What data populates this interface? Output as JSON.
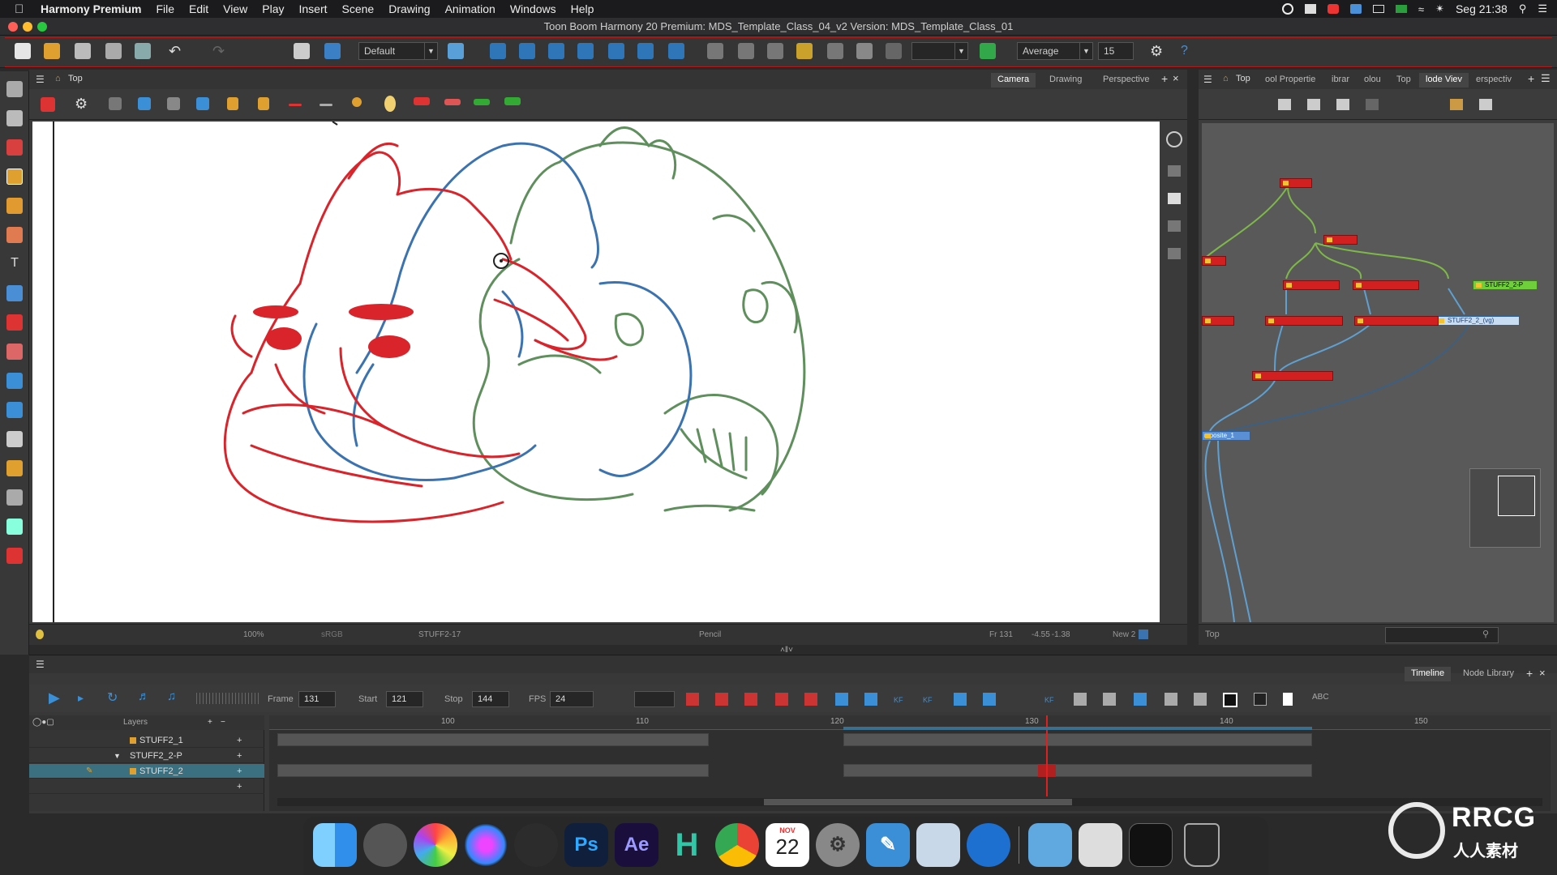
{
  "menubar": {
    "app_name": "Harmony Premium",
    "items": [
      "File",
      "Edit",
      "View",
      "Play",
      "Insert",
      "Scene",
      "Drawing",
      "Animation",
      "Windows",
      "Help"
    ],
    "clock": "Seg 21:38"
  },
  "window": {
    "title": "Toon Boom Harmony 20 Premium: MDS_Template_Class_04_v2 Version: MDS_Template_Class_01"
  },
  "toolbar": {
    "workspace_value": "Default",
    "smoothing_value": "Average",
    "size_value": "15"
  },
  "camera": {
    "breadcrumb": "Top",
    "tabs": [
      "Camera",
      "Drawing",
      "Perspective"
    ],
    "status": {
      "zoom": "100%",
      "layer": "STUFF2-17",
      "tool": "Pencil",
      "frame": "Fr 131",
      "coords": "-4.55 -1.38",
      "new": "New 2",
      "color_mode": "sRGB"
    }
  },
  "node_view": {
    "breadcrumb": "Top",
    "tabs": [
      "ool Propertie",
      "ibrar",
      "olou",
      "Top",
      "lode Viev",
      "erspectiv"
    ],
    "footer": "Top",
    "nodes": [
      {
        "label": "",
        "selected": false
      },
      {
        "label": "",
        "selected": false
      },
      {
        "label": "",
        "selected": false
      },
      {
        "label": "",
        "selected": false
      },
      {
        "label": "STUFF2_2-P",
        "selected": false
      },
      {
        "label": "",
        "selected": false
      },
      {
        "label": "",
        "selected": false
      },
      {
        "label": "",
        "selected": false
      },
      {
        "label": "STUFF2_2_(vg)",
        "selected": true
      },
      {
        "label": "",
        "selected": false
      },
      {
        "label": "mposite_1",
        "selected": false
      }
    ]
  },
  "timeline": {
    "tabs": [
      "Timeline",
      "Node Library"
    ],
    "frame_label": "Frame",
    "frame_value": "131",
    "start_label": "Start",
    "start_value": "121",
    "stop_label": "Stop",
    "stop_value": "144",
    "fps_label": "FPS",
    "fps_value": "24",
    "layers_header": "Layers",
    "layers": [
      {
        "name": "STUFF2_1",
        "selected": false
      },
      {
        "name": "STUFF2_2-P",
        "selected": false
      },
      {
        "name": "STUFF2_2",
        "selected": true
      },
      {
        "name": "",
        "selected": false
      }
    ],
    "ruler": [
      "100",
      "110",
      "120",
      "130",
      "140",
      "150"
    ],
    "keyframe_labels": [
      "KF",
      "KF",
      "KF"
    ]
  },
  "dock": {
    "apps": [
      "finder-icon",
      "launchpad-icon",
      "photos-icon",
      "siri-icon",
      "davinci-icon",
      "Ps",
      "Ae",
      "H",
      "chrome-icon",
      "calendar-icon",
      "settings-icon",
      "pen-icon",
      "preview-icon",
      "safari-icon",
      "folder-icon",
      "screenshot-icon",
      "terminal-icon",
      "trash-icon"
    ],
    "calendar_month": "NOV",
    "calendar_day": "22"
  },
  "watermark": {
    "brand": "RRCG",
    "sub": "人人素材"
  },
  "colors": {
    "accent_red": "#d21f1f",
    "stroke_red": "#d8242a",
    "stroke_blue": "#3b72b0",
    "stroke_green": "#5f8f5c",
    "selection_teal": "#3b7080"
  }
}
